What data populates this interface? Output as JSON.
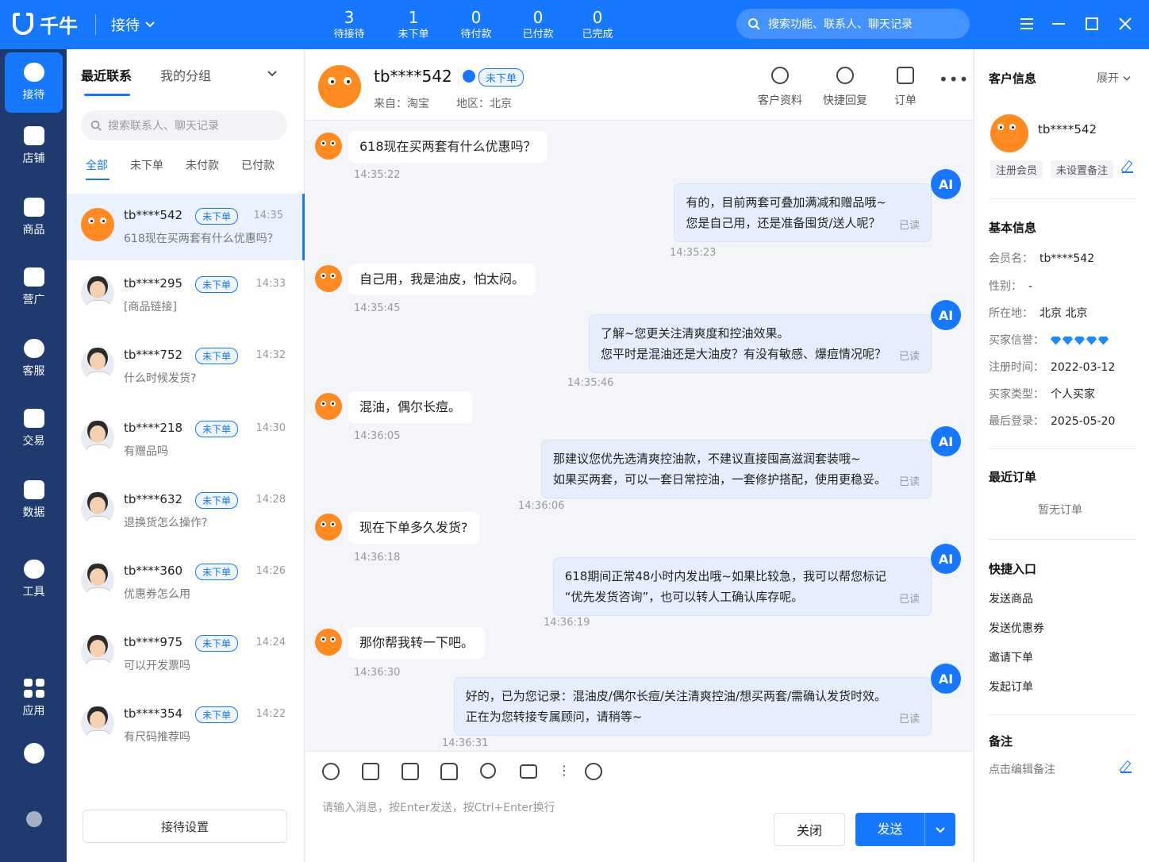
{
  "app": {
    "name": "千牛",
    "mode": "接待"
  },
  "stats": [
    {
      "num": "3",
      "label": "待接待"
    },
    {
      "num": "1",
      "label": "未下单"
    },
    {
      "num": "0",
      "label": "待付款"
    },
    {
      "num": "0",
      "label": "已付款"
    },
    {
      "num": "0",
      "label": "已完成"
    }
  ],
  "search": {
    "placeholder": "搜索功能、联系人、聊天记录"
  },
  "nav": [
    "接待",
    "店铺",
    "商品",
    "营广",
    "客服",
    "交易",
    "数据",
    "工具",
    "应用"
  ],
  "contacts": {
    "tabs": [
      "最近联系",
      "我的分组"
    ],
    "search_placeholder": "搜索联系人、聊天记录",
    "filters": [
      "全部",
      "未下单",
      "未付款",
      "已付款"
    ],
    "items": [
      {
        "name": "tb****542",
        "badge": "未下单",
        "time": "14:35",
        "preview": "618现在买两套有什么优惠吗？"
      },
      {
        "name": "tb****295",
        "badge": "未下单",
        "time": "14:33",
        "preview": "[商品链接]"
      },
      {
        "name": "tb****752",
        "badge": "未下单",
        "time": "14:32",
        "preview": "什么时候发货?"
      },
      {
        "name": "tb****218",
        "badge": "未下单",
        "time": "14:30",
        "preview": "有赠品吗"
      },
      {
        "name": "tb****632",
        "badge": "未下单",
        "time": "14:28",
        "preview": "退换货怎么操作?"
      },
      {
        "name": "tb****360",
        "badge": "未下单",
        "time": "14:26",
        "preview": "优惠券怎么用"
      },
      {
        "name": "tb****975",
        "badge": "未下单",
        "time": "14:24",
        "preview": "可以开发票吗"
      },
      {
        "name": "tb****354",
        "badge": "未下单",
        "time": "14:22",
        "preview": "有尺码推荐吗"
      }
    ],
    "settings_label": "接待设置"
  },
  "chat": {
    "name": "tb****542",
    "badge": "未下单",
    "source": "来自：淘宝",
    "region": "地区：北京",
    "actions": [
      "客户资料",
      "快捷回复",
      "订单"
    ],
    "more": "•••",
    "ai_label": "AI",
    "read_label": "已读",
    "messages": [
      {
        "text": "618现在买两套有什么优惠吗？",
        "time": "14:35:22"
      },
      {
        "lines": [
          "有的，目前两套可叠加满减和赠品哦~",
          "您是自己用，还是准备囤货/送人呢？"
        ],
        "time": "14:35:23"
      },
      {
        "text": "自己用，我是油皮，怕太闷。",
        "time": "14:35:45"
      },
      {
        "lines": [
          "了解~您更关注清爽度和控油效果。",
          "您平时是混油还是大油皮？有没有敏感、爆痘情况呢？"
        ],
        "time": "14:35:46"
      },
      {
        "text": "混油，偶尔长痘。",
        "time": "14:36:05"
      },
      {
        "lines": [
          "那建议您优先选清爽控油款，不建议直接囤高滋润套装哦~",
          "如果买两套，可以一套日常控油，一套修护搭配，使用更稳妥。"
        ],
        "time": "14:36:06"
      },
      {
        "text": "现在下单多久发货?",
        "time": "14:36:18"
      },
      {
        "lines": [
          "618期间正常48小时内发出哦~如果比较急，我可以帮您标记",
          "“优先发货咨询”，也可以转人工确认库存呢。"
        ],
        "time": "14:36:19"
      },
      {
        "text": "那你帮我转一下吧。",
        "time": "14:36:30"
      },
      {
        "lines": [
          "好的，已为您记录：混油皮/偶尔长痘/关注清爽控油/想买两套/需确认发货时效。",
          "正在为您转接专属顾问，请稍等~"
        ],
        "time": "14:36:31"
      }
    ],
    "composer_placeholder": "请输入消息，按Enter发送，按Ctrl+Enter换行",
    "close_label": "关闭",
    "send_label": "发送"
  },
  "customer": {
    "title": "客户信息",
    "expand": "展开",
    "name": "tb****542",
    "tags": [
      "注册会员",
      "未设置备注"
    ],
    "basic_title": "基本信息",
    "basic": [
      {
        "k": "会员名：",
        "v": "tb****542"
      },
      {
        "k": "性别：",
        "v": "-"
      },
      {
        "k": "所在地：",
        "v": "北京 北京"
      },
      {
        "k": "买家信誉：",
        "v": ""
      },
      {
        "k": "注册时间：",
        "v": "2022-03-12"
      },
      {
        "k": "买家类型：",
        "v": "个人买家"
      },
      {
        "k": "最后登录：",
        "v": "2025-05-20"
      }
    ],
    "orders_title": "最近订单",
    "orders_empty": "暂无订单",
    "quick_title": "快捷入口",
    "quick": [
      "发送商品",
      "发送优惠券",
      "邀请下单",
      "发起订单"
    ],
    "note_title": "备注",
    "note_placeholder": "点击编辑备注"
  }
}
